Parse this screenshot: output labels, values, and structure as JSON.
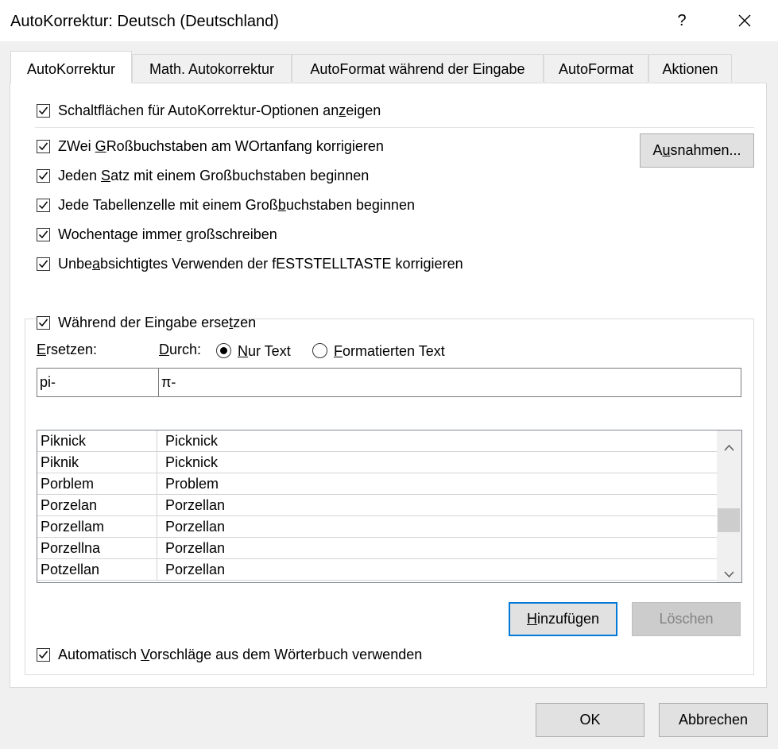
{
  "window": {
    "title": "AutoKorrektur: Deutsch (Deutschland)",
    "help_glyph": "?"
  },
  "tabs": [
    {
      "label": "AutoKorrektur",
      "active": true
    },
    {
      "label": "Math. Autokorrektur",
      "active": false
    },
    {
      "label": "AutoFormat während der Eingabe",
      "active": false
    },
    {
      "label": "AutoFormat",
      "active": false
    },
    {
      "label": "Aktionen",
      "active": false
    }
  ],
  "options": {
    "show_buttons": {
      "pre": "Schaltflächen für AutoKorrektur-Optionen an",
      "key": "z",
      "post": "eigen",
      "checked": true
    },
    "two_caps": {
      "pre": "ZWei ",
      "key": "G",
      "post": "Roßbuchstaben am WOrtanfang korrigieren",
      "checked": true
    },
    "sentence_caps": {
      "pre": "Jeden ",
      "key": "S",
      "post": "atz mit einem Großbuchstaben beginnen",
      "checked": true
    },
    "table_caps": {
      "pre": "Jede Tabellenzelle mit einem Groß",
      "key": "b",
      "post": "uchstaben beginnen",
      "checked": true
    },
    "weekdays": {
      "pre": "Wochentage imme",
      "key": "r",
      "post": " großschreiben",
      "checked": true
    },
    "capslock": {
      "pre": "Unbe",
      "key": "a",
      "post": "bsichtigtes Verwenden der fESTSTELLTASTE korrigieren",
      "checked": true
    }
  },
  "exceptions_button": {
    "pre": "A",
    "key": "u",
    "post": "snahmen..."
  },
  "replace_group": {
    "toggle": {
      "pre": "Während der Eingabe erse",
      "key": "t",
      "post": "zen",
      "checked": true
    },
    "replace_label": {
      "pre": "",
      "key": "E",
      "post": "rsetzen:"
    },
    "with_label": {
      "pre": "",
      "key": "D",
      "post": "urch:"
    },
    "radio_plain": {
      "pre": "",
      "key": "N",
      "post": "ur Text",
      "selected": true
    },
    "radio_formatted": {
      "pre": "",
      "key": "F",
      "post": "ormatierten Text",
      "selected": false
    },
    "replace_value": "pi-",
    "with_value": "π-",
    "entries": [
      {
        "from": "Piknick",
        "to": "Picknick"
      },
      {
        "from": "Piknik",
        "to": "Picknick"
      },
      {
        "from": "Porblem",
        "to": "Problem"
      },
      {
        "from": "Porzelan",
        "to": "Porzellan"
      },
      {
        "from": "Porzellam",
        "to": "Porzellan"
      },
      {
        "from": "Porzellna",
        "to": "Porzellan"
      },
      {
        "from": "Potzellan",
        "to": "Porzellan"
      }
    ],
    "add_button": {
      "pre": "",
      "key": "H",
      "post": "inzufügen"
    },
    "delete_button": "Löschen",
    "dictionary": {
      "pre": "Automatisch ",
      "key": "V",
      "post": "orschläge aus dem Wörterbuch verwenden",
      "checked": true
    }
  },
  "footer": {
    "ok": "OK",
    "cancel": "Abbrechen"
  }
}
